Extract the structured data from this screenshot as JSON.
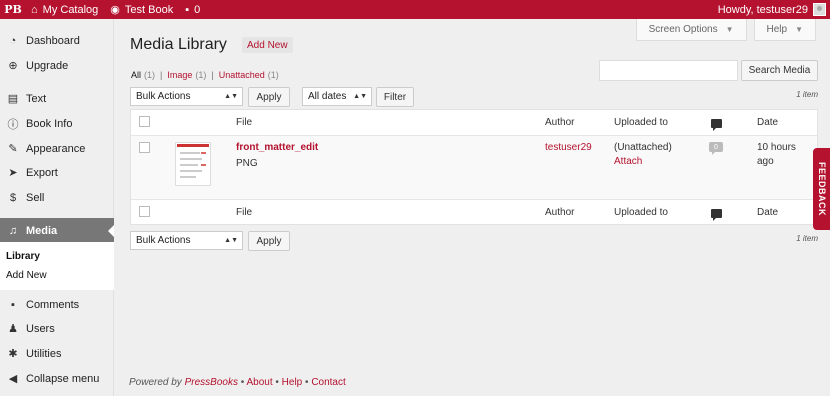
{
  "adminbar": {
    "logo": "PB",
    "catalog": "My Catalog",
    "book": "Test Book",
    "comments": "0",
    "greeting": "Howdy, testuser29"
  },
  "sidebar": {
    "items": [
      {
        "label": "Dashboard",
        "icon": "dashboard-icon"
      },
      {
        "label": "Upgrade",
        "icon": "upgrade-icon"
      },
      {
        "label": "Text",
        "icon": "book-icon"
      },
      {
        "label": "Book Info",
        "icon": "info-icon"
      },
      {
        "label": "Appearance",
        "icon": "paintbrush-icon"
      },
      {
        "label": "Export",
        "icon": "export-icon"
      },
      {
        "label": "Sell",
        "icon": "dollar-icon"
      },
      {
        "label": "Media",
        "icon": "media-icon"
      },
      {
        "label": "Comments",
        "icon": "comment-icon"
      },
      {
        "label": "Users",
        "icon": "user-icon"
      },
      {
        "label": "Utilities",
        "icon": "wrench-icon"
      },
      {
        "label": "Collapse menu",
        "icon": "collapse-icon"
      }
    ],
    "submenu": [
      "Library",
      "Add New"
    ]
  },
  "screen": {
    "options": "Screen Options",
    "help": "Help"
  },
  "page": {
    "title": "Media Library",
    "add_new": "Add New"
  },
  "filters": {
    "all": "All",
    "all_count": "(1)",
    "image": "Image",
    "image_count": "(1)",
    "unattached": "Unattached",
    "unattached_count": "(1)"
  },
  "search": {
    "placeholder": "",
    "button": "Search Media"
  },
  "top_nav": {
    "bulk": "Bulk Actions",
    "apply": "Apply",
    "dates": "All dates",
    "filter": "Filter",
    "count": "1 item"
  },
  "table": {
    "columns": {
      "file": "File",
      "author": "Author",
      "uploaded": "Uploaded to",
      "date": "Date"
    },
    "rows": [
      {
        "title": "front_matter_edit",
        "type": "PNG",
        "author": "testuser29",
        "uploaded": "(Unattached)",
        "attach": "Attach",
        "comments": "0",
        "date_line1": "10 hours",
        "date_line2": "ago"
      }
    ]
  },
  "bottom_nav": {
    "bulk": "Bulk Actions",
    "apply": "Apply",
    "count": "1 item"
  },
  "footer": {
    "powered": "Powered by ",
    "brand": "PressBooks",
    "bullet": " • ",
    "about": "About",
    "help": "Help",
    "contact": "Contact"
  },
  "feedback": "FEEDBACK",
  "colors": {
    "brand": "#b4122e",
    "active_menu": "#777777",
    "background": "#efefef"
  }
}
